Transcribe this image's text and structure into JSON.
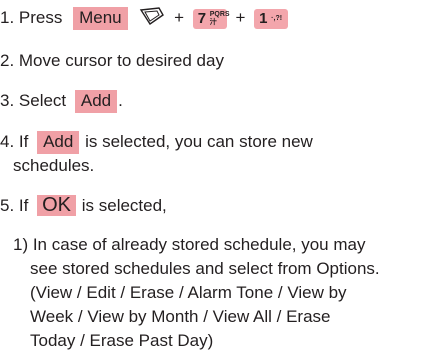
{
  "steps": {
    "s1": {
      "text": "1. Press",
      "key": "Menu",
      "plus": "+",
      "key7_num": "7",
      "key7_sub": "PQRS\n汁",
      "key1_num": "1",
      "key1_sub": "·,?!"
    },
    "s2": {
      "text": "2. Move cursor to desired day"
    },
    "s3": {
      "prefix": "3. Select",
      "key": "Add",
      "suffix": "."
    },
    "s4": {
      "prefix": "4. If",
      "key": "Add",
      "suffix": "is selected, you can store new",
      "cont": "schedules."
    },
    "s5": {
      "prefix": "5. If",
      "key": "OK",
      "suffix": "is selected,"
    },
    "sub1": {
      "lines": [
        "1) In case of already stored schedule, you may",
        "see stored schedules and select from Options.",
        "(View / Edit / Erase / Alarm Tone / View by",
        "Week / View by Month / View All / Erase",
        "Today / Erase Past Day)"
      ]
    }
  },
  "icons": {
    "nav": "nav-key-icon"
  },
  "colors": {
    "highlight": "#f0a0a6",
    "text": "#231f20"
  }
}
